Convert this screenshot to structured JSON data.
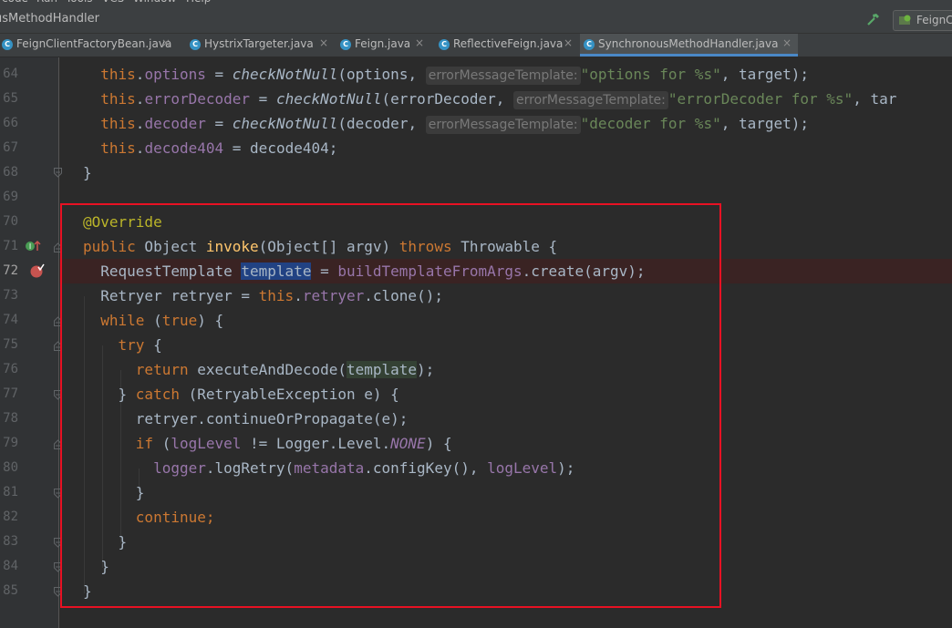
{
  "nav": {
    "breadcrumb": "usMethodHandler",
    "run_config": "FeignC"
  },
  "tabs": [
    {
      "label": "FeignClientFactoryBean.java",
      "icon": "class-icon",
      "active": false
    },
    {
      "label": "HystrixTargeter.java",
      "icon": "class-icon",
      "active": false
    },
    {
      "label": "Feign.java",
      "icon": "class-icon",
      "active": false
    },
    {
      "label": "ReflectiveFeign.java",
      "icon": "class-icon",
      "active": false
    },
    {
      "label": "SynchronousMethodHandler.java",
      "icon": "class-icon",
      "active": true
    }
  ],
  "close_glyph": "×",
  "editor": {
    "current_line": 72,
    "breakpoint_line": 72,
    "highlight_box": {
      "from_line": 70,
      "to_line": 85,
      "color": "#e81123"
    },
    "lines": [
      {
        "n": "64",
        "text": "    this.options = checkNotNull(options, errorMessageTemplate: \"options for %s\", target);"
      },
      {
        "n": "65",
        "text": "    this.errorDecoder = checkNotNull(errorDecoder, errorMessageTemplate: \"errorDecoder for %s\", tar"
      },
      {
        "n": "66",
        "text": "    this.decoder = checkNotNull(decoder, errorMessageTemplate: \"decoder for %s\", target);"
      },
      {
        "n": "67",
        "text": "    this.decode404 = decode404;"
      },
      {
        "n": "68",
        "text": "  }"
      },
      {
        "n": "69",
        "text": ""
      },
      {
        "n": "70",
        "text": "  @Override"
      },
      {
        "n": "71",
        "text": "  public Object invoke(Object[] argv) throws Throwable {"
      },
      {
        "n": "72",
        "text": "    RequestTemplate template = buildTemplateFromArgs.create(argv);"
      },
      {
        "n": "73",
        "text": "    Retryer retryer = this.retryer.clone();"
      },
      {
        "n": "74",
        "text": "    while (true) {"
      },
      {
        "n": "75",
        "text": "      try {"
      },
      {
        "n": "76",
        "text": "        return executeAndDecode(template);"
      },
      {
        "n": "77",
        "text": "      } catch (RetryableException e) {"
      },
      {
        "n": "78",
        "text": "        retryer.continueOrPropagate(e);"
      },
      {
        "n": "79",
        "text": "        if (logLevel != Logger.Level.NONE) {"
      },
      {
        "n": "80",
        "text": "          logger.logRetry(metadata.configKey(), logLevel);"
      },
      {
        "n": "81",
        "text": "        }"
      },
      {
        "n": "82",
        "text": "        continue;"
      },
      {
        "n": "83",
        "text": "      }"
      },
      {
        "n": "84",
        "text": "    }"
      },
      {
        "n": "85",
        "text": "  }"
      }
    ]
  },
  "tokens": {
    "this": "this",
    "dot": ".",
    "assign": " = ",
    "comma": ", ",
    "lp": "(",
    "rp": ")",
    "end": ");",
    "semi": ";",
    "options": "options",
    "errorDecoder": "errorDecoder",
    "decoder": "decoder",
    "decode404": "decode404",
    "checkNotNull": "checkNotNull",
    "hint": "errorMessageTemplate:",
    "s_options": "\"options for %s\"",
    "s_errorDecoder": "\"errorDecoder for %s\"",
    "s_decoder": "\"decoder for %s\"",
    "target_end": ", target);",
    "tar": ", tar",
    "close_brace": "}",
    "override": "@Override",
    "public": "public",
    "object": " Object ",
    "invoke": "invoke",
    "sig": "(Object[] argv) ",
    "throws": "throws",
    "throwable": " Throwable {",
    "request_template": "RequestTemplate ",
    "template": "template",
    "build_field": "buildTemplateFromArgs",
    "create": ".create(argv);",
    "retryer_decl": "Retryer retryer = ",
    "retryer": "retryer",
    "clone": ".clone();",
    "while": "while",
    "true": "true",
    "open_after": ") {",
    "try": "try",
    "brace_open": " {",
    "return": "return",
    "execute": " executeAndDecode(",
    "close_catch": "} ",
    "catch": "catch",
    "catch_args": " (RetryableException e) {",
    "continue_stmt": "retryer.continueOrPropagate(e);",
    "if": "if",
    "loglevel": "logLevel",
    "neq": " != Logger.Level.",
    "none": "NONE",
    "logger": "logger",
    "logretry": ".logRetry(",
    "metadata": "metadata",
    "configkey": ".configKey(), ",
    "continue": "continue"
  }
}
